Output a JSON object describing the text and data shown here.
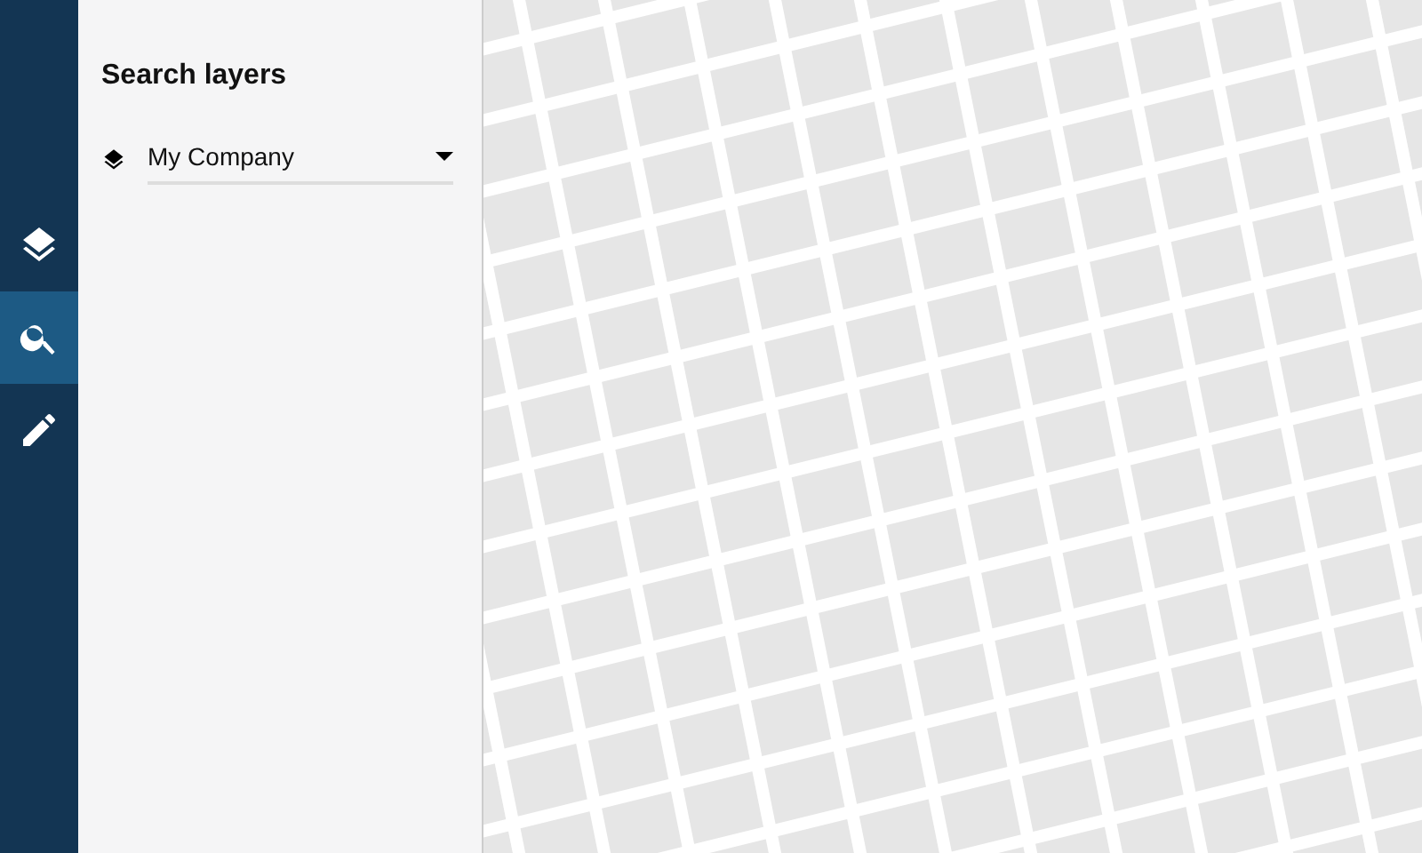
{
  "nav": [
    {
      "kind": "layers",
      "selected": false
    },
    {
      "kind": "search",
      "selected": true
    },
    {
      "kind": "edit",
      "selected": false
    }
  ],
  "panel": {
    "title": "Search layers",
    "layer_select": {
      "value": "My Company"
    }
  }
}
